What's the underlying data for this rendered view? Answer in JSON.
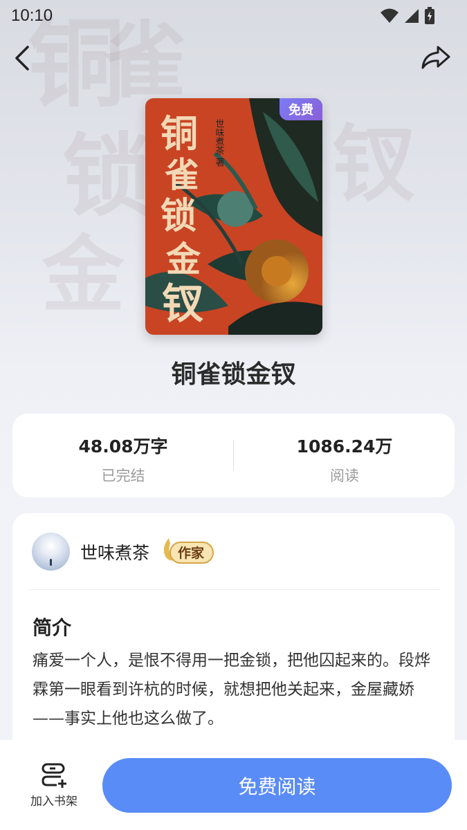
{
  "status_bar": {
    "time": "10:10"
  },
  "book": {
    "title": "铜雀锁金钗",
    "cover_badge": "免费",
    "cover_title_chars": [
      "铜",
      "雀",
      "锁",
      "金",
      "钗"
    ],
    "cover_author_vertical": "世味煮茶 著"
  },
  "stats": {
    "words": {
      "value": "48.08万字",
      "label": "已完结"
    },
    "reads": {
      "value": "1086.24万",
      "label": "阅读"
    }
  },
  "author": {
    "name": "世味煮茶",
    "badge": "作家"
  },
  "intro": {
    "heading": "简介",
    "text": "痛爱一个人，是恨不得用一把金锁，把他囚起来的。段烨霖第一眼看到许杭的时候，就想把他关起来，金屋藏娇——事实上他也这么做了。"
  },
  "bottom_bar": {
    "shelf_label": "加入书架",
    "read_label": "免费阅读"
  },
  "colors": {
    "accent": "#5a8cf7",
    "badge": "#7b7cf5"
  },
  "icons": [
    "back-icon",
    "share-icon",
    "wifi-icon",
    "signal-icon",
    "battery-icon",
    "bookshelf-add-icon"
  ]
}
